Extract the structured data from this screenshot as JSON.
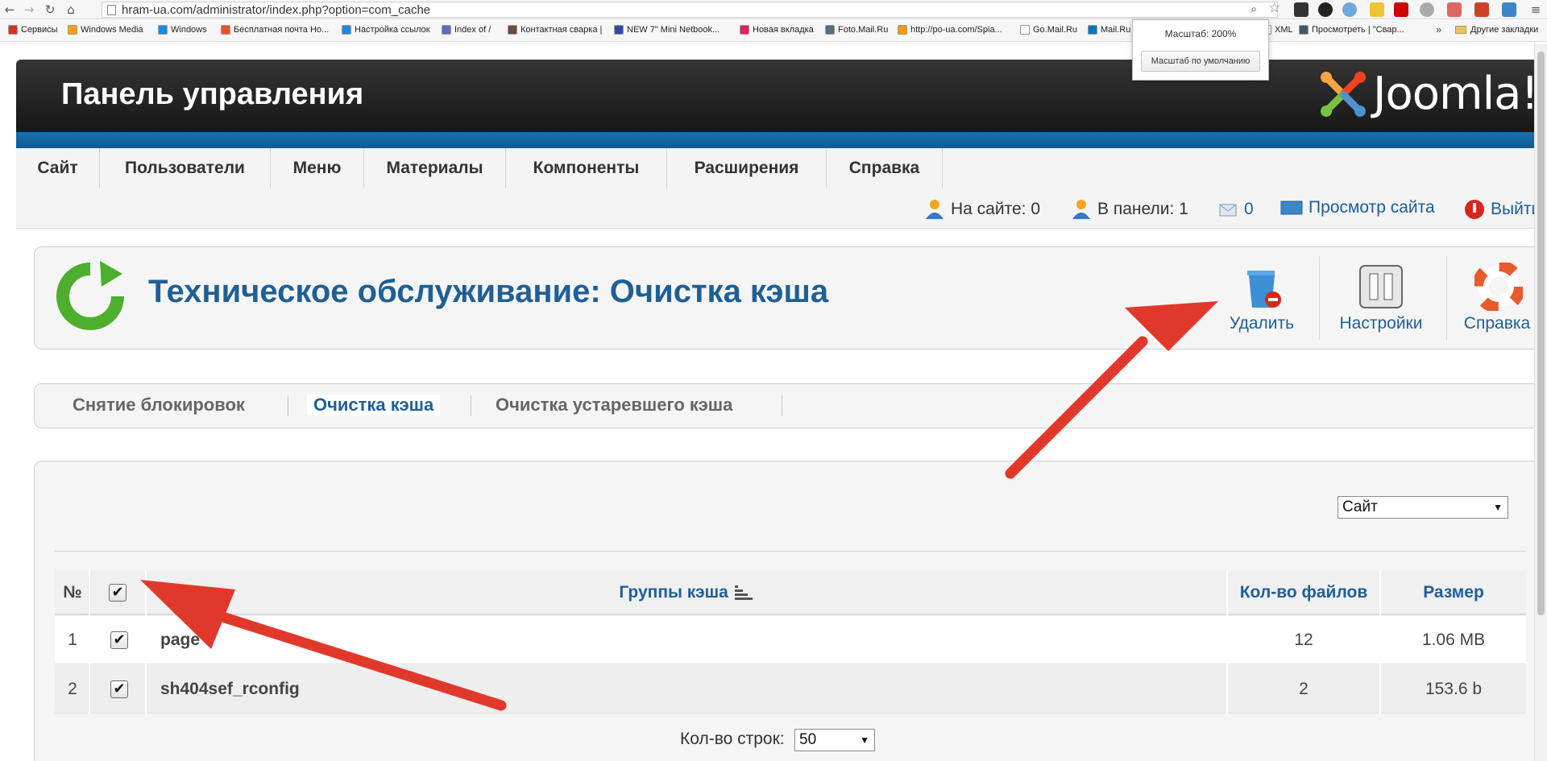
{
  "browser": {
    "url": "hram-ua.com/administrator/index.php?option=com_cache",
    "bookmarks": [
      {
        "label": "Сервисы",
        "color": "#d93025"
      },
      {
        "label": "Windows Media",
        "color": "#f4a300"
      },
      {
        "label": "Windows",
        "color": "#1e88e5"
      },
      {
        "label": "Бесплатная почта Ho...",
        "color": "#f25022"
      },
      {
        "label": "Настройка ссылок",
        "color": "#1e88e5"
      },
      {
        "label": "Index of /",
        "color": "#5c6bc0"
      },
      {
        "label": "Контактная сварка |",
        "color": "#6d4c41"
      },
      {
        "label": "NEW 7\" Mini Netbook...",
        "color": "#3949ab"
      },
      {
        "label": "Новая вкладка",
        "color": "#e91e63"
      },
      {
        "label": "Foto.Mail.Ru",
        "color": "#546e7a"
      },
      {
        "label": "http://po-ua.com/Spia...",
        "color": "#ff9800"
      },
      {
        "label": "Go.Mail.Ru",
        "color": "#ffffff"
      },
      {
        "label": "Mail.Ru",
        "color": "#0277bd"
      },
      {
        "label": "XML",
        "color": "#ffffff"
      },
      {
        "label": "Просмотреть | \"Свар...",
        "color": "#455a64"
      }
    ],
    "bookmarks_more": "»",
    "other_bookmarks": "Другие закладки",
    "zoom_popup": {
      "label": "Масштаб: 200%",
      "reset_button": "Масштаб по умолчанию"
    }
  },
  "header": {
    "title": "Панель управления",
    "logo_text": "Joomla!"
  },
  "menu": {
    "items": [
      "Сайт",
      "Пользователи",
      "Меню",
      "Материалы",
      "Компоненты",
      "Расширения",
      "Справка"
    ]
  },
  "status": {
    "on_site": "На сайте: 0",
    "in_panel": "В панели: 1",
    "messages": "0",
    "view_site": "Просмотр сайта",
    "logout": "Выйти"
  },
  "toolbar": {
    "title": "Техническое обслуживание: Очистка кэша",
    "delete": "Удалить",
    "settings": "Настройки",
    "help": "Справка"
  },
  "submenu": {
    "items": [
      "Снятие блокировок",
      "Очистка кэша",
      "Очистка устаревшего кэша"
    ],
    "active": "Очистка кэша"
  },
  "filter": {
    "client_select": "Сайт"
  },
  "table": {
    "headers": {
      "num": "№",
      "group": "Группы кэша",
      "files": "Кол-во файлов",
      "size": "Размер"
    },
    "rows": [
      {
        "num": "1",
        "group": "page",
        "files": "12",
        "size": "1.06 MB",
        "checked": true
      },
      {
        "num": "2",
        "group": "sh404sef_rconfig",
        "files": "2",
        "size": "153.6 b",
        "checked": true
      }
    ],
    "check_all": true
  },
  "pagination": {
    "rows_label": "Кол-во строк:",
    "rows_value": "50"
  },
  "annotation_arrow_color": "#e0392b"
}
